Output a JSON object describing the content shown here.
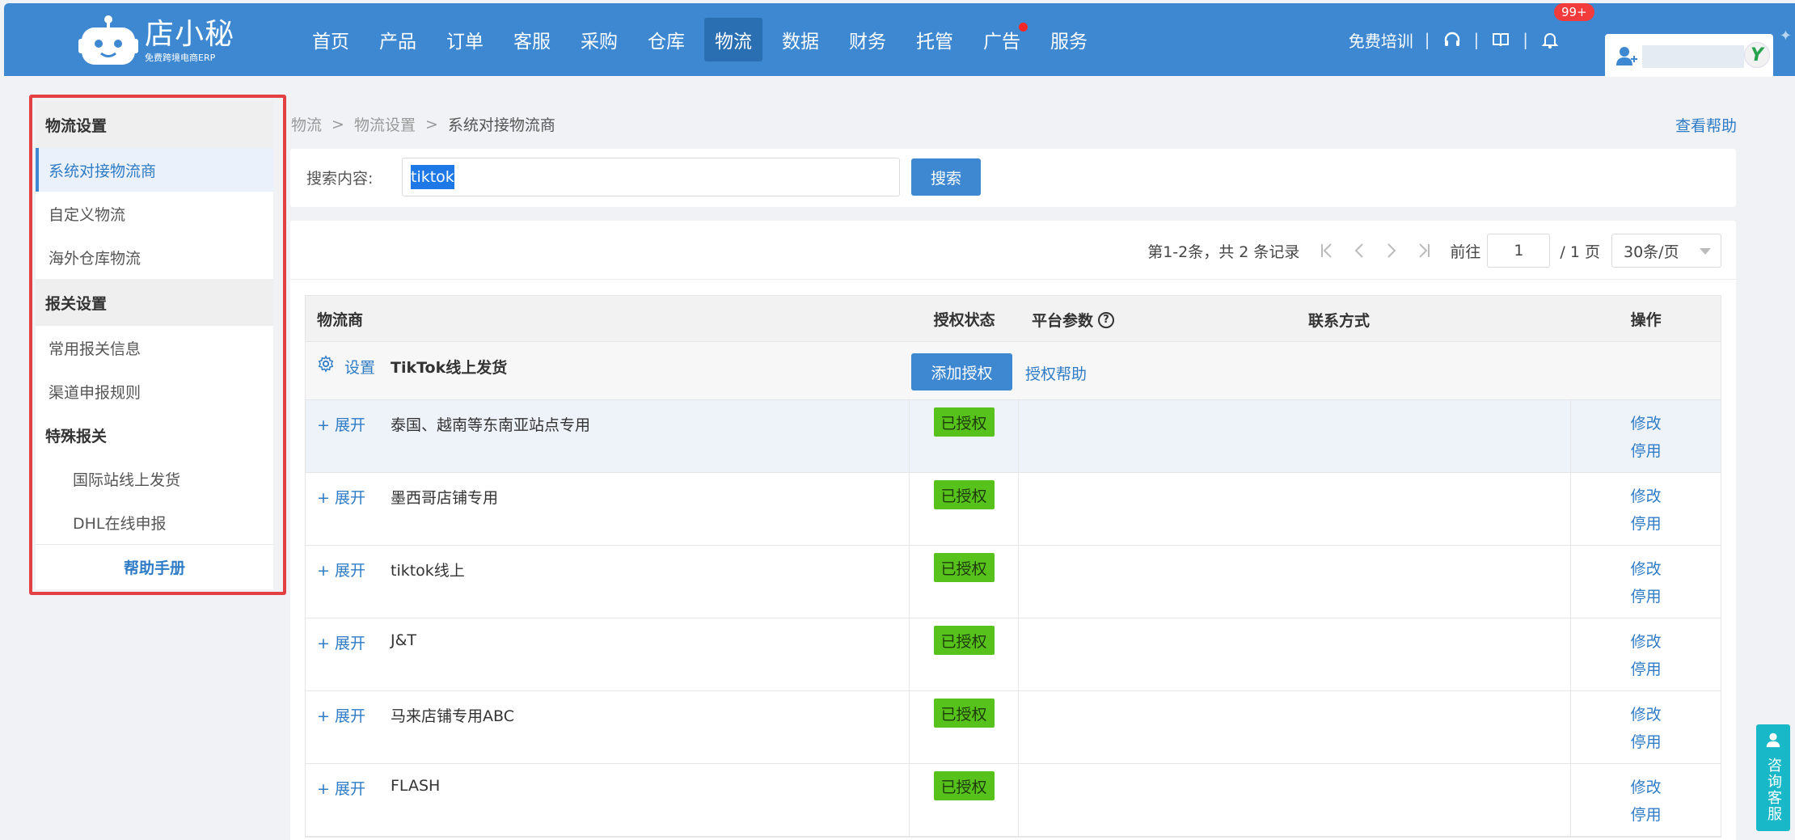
{
  "logo": {
    "main": "店小秘",
    "sub": "免费跨境电商ERP"
  },
  "nav": [
    {
      "label": "首页"
    },
    {
      "label": "产品"
    },
    {
      "label": "订单"
    },
    {
      "label": "客服"
    },
    {
      "label": "采购"
    },
    {
      "label": "仓库"
    },
    {
      "label": "物流"
    },
    {
      "label": "数据"
    },
    {
      "label": "财务"
    },
    {
      "label": "托管"
    },
    {
      "label": "广告"
    },
    {
      "label": "服务"
    }
  ],
  "nav_active": "物流",
  "header_tools": {
    "training": "免费培训",
    "notification_badge": "99+"
  },
  "sidebar": {
    "group1": "物流设置",
    "items1": [
      "系统对接物流商",
      "自定义物流",
      "海外仓库物流"
    ],
    "group2": "报关设置",
    "items2": [
      "常用报关信息",
      "渠道申报规则"
    ],
    "sub_group": "特殊报关",
    "sub_items": [
      "国际站线上发货",
      "DHL在线申报"
    ],
    "help": "帮助手册"
  },
  "breadcrumb": [
    "物流",
    "物流设置",
    "系统对接物流商"
  ],
  "help_link": "查看帮助",
  "search": {
    "label": "搜索内容:",
    "value": "tiktok",
    "button": "搜索"
  },
  "pager": {
    "summary": "第1-2条，共 2 条记录",
    "goto": "前往",
    "page": "1",
    "total": "/ 1 页",
    "page_size": "30条/页"
  },
  "table": {
    "headers": {
      "carrier": "物流商",
      "auth_status": "授权状态",
      "platform_params": "平台参数",
      "contact": "联系方式",
      "actions": "操作"
    },
    "group": {
      "settings": "设置",
      "title": "TikTok线上发货",
      "add_auth": "添加授权",
      "auth_help": "授权帮助"
    },
    "rows": [
      {
        "expand": "+ 展开",
        "name": "泰国、越南等东南亚站点专用",
        "status": "已授权",
        "edit": "修改",
        "disable": "停用"
      },
      {
        "expand": "+ 展开",
        "name": "墨西哥店铺专用",
        "status": "已授权",
        "edit": "修改",
        "disable": "停用"
      },
      {
        "expand": "+ 展开",
        "name": "tiktok线上",
        "status": "已授权",
        "edit": "修改",
        "disable": "停用"
      },
      {
        "expand": "+ 展开",
        "name": "J&T",
        "status": "已授权",
        "edit": "修改",
        "disable": "停用"
      },
      {
        "expand": "+ 展开",
        "name": "马来店铺专用ABC",
        "status": "已授权",
        "edit": "修改",
        "disable": "停用"
      },
      {
        "expand": "+ 展开",
        "name": "FLASH",
        "status": "已授权",
        "edit": "修改",
        "disable": "停用"
      }
    ]
  },
  "consult": "咨询客服",
  "colors": {
    "primary": "#3d88d1",
    "authorized": "#58c21c",
    "highlight_border": "#e34043",
    "consult": "#19b8c8"
  },
  "icons": [
    "robot-logo-icon",
    "headset-icon",
    "book-icon",
    "bell-icon",
    "user-icon",
    "gear-icon",
    "help-circle-icon",
    "first-page-icon",
    "prev-page-icon",
    "next-page-icon",
    "last-page-icon",
    "chevron-down-icon",
    "chat-icon"
  ]
}
